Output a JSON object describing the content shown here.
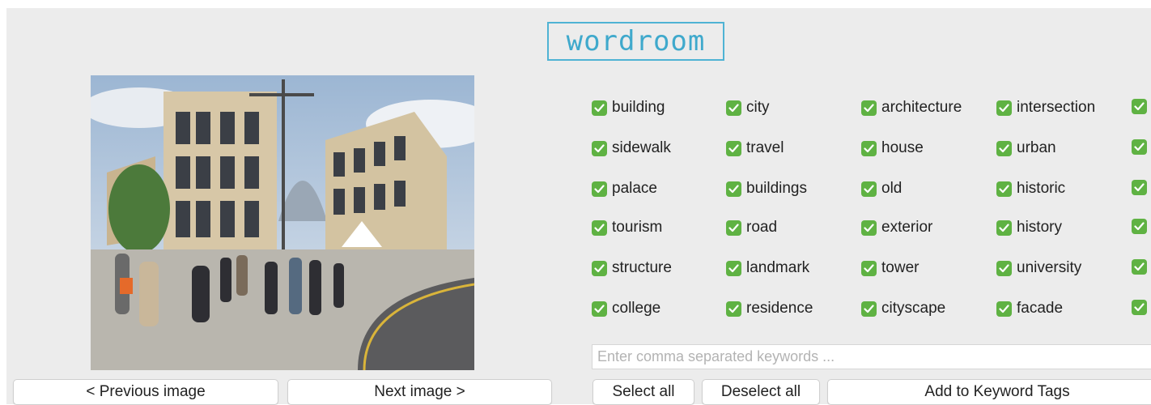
{
  "app": {
    "logo_text": "wordroom"
  },
  "nav": {
    "prev_label": "< Previous image",
    "next_label": "Next image >"
  },
  "keywords": {
    "columns": [
      [
        "building",
        "sidewalk",
        "palace",
        "tourism",
        "structure",
        "college"
      ],
      [
        "city",
        "travel",
        "buildings",
        "road",
        "landmark",
        "residence"
      ],
      [
        "architecture",
        "house",
        "old",
        "exterior",
        "tower",
        "cityscape"
      ],
      [
        "intersection",
        "urban",
        "historic",
        "history",
        "university",
        "facade"
      ],
      [
        "",
        "",
        "",
        "",
        "",
        ""
      ]
    ],
    "checked": true,
    "input_placeholder": "Enter comma separated keywords ...",
    "input_value": ""
  },
  "actions": {
    "select_all_label": "Select all",
    "deselect_all_label": "Deselect all",
    "add_label": "Add to Keyword Tags"
  },
  "colors": {
    "accent": "#4fb3d4",
    "checkbox": "#5fb243",
    "background": "#ececec"
  },
  "icons": {
    "checkbox": "checkmark-icon"
  }
}
